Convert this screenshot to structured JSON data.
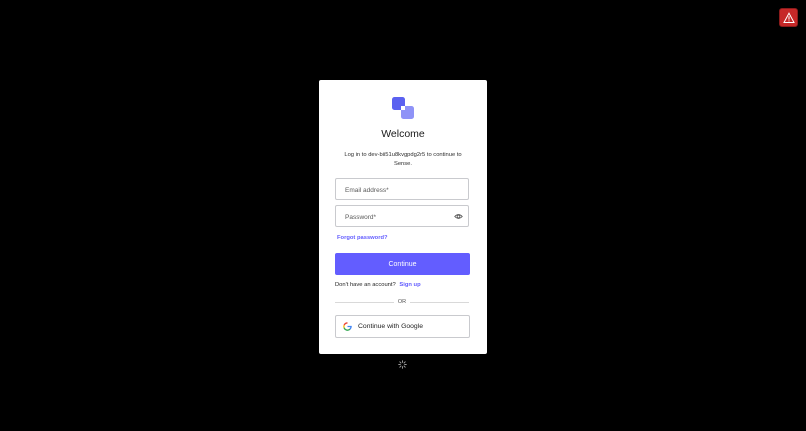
{
  "icons": {
    "alert": "warning-triangle-icon",
    "logo": "overlapping-squares-logo",
    "password_toggle": "eye-icon",
    "google": "google-g-icon",
    "loading": "spinner-icon"
  },
  "colors": {
    "background": "#000000",
    "card": "#ffffff",
    "accent": "#635dff",
    "alert": "#c62828"
  },
  "login": {
    "title": "Welcome",
    "subtitle": "Log in to dev-bii51u8kvgpdg2r5 to continue to Sense.",
    "email": {
      "placeholder": "Email address*",
      "value": ""
    },
    "password": {
      "placeholder": "Password*",
      "value": ""
    },
    "forgot_password": "Forgot password?",
    "continue_label": "Continue",
    "signup_prompt": "Don't have an account?",
    "signup_link": "Sign up",
    "divider_text": "OR",
    "google_label": "Continue with Google"
  }
}
